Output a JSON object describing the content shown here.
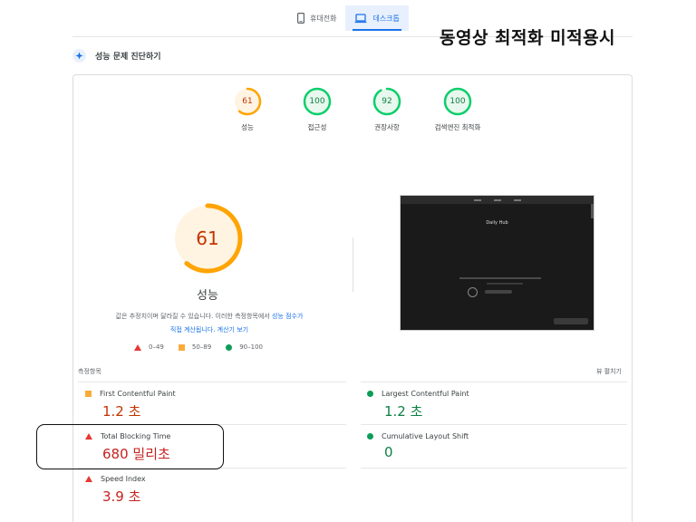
{
  "device_tabs": [
    {
      "label": "휴대전화",
      "icon": "smartphone-icon",
      "active": false
    },
    {
      "label": "데스크톱",
      "icon": "laptop-icon",
      "active": true
    }
  ],
  "overlay_title": "동영상 최적화 미적용시",
  "diagnose": {
    "label": "성능 문제 진단하기",
    "icon": "lighthouse-icon"
  },
  "category_scores": [
    {
      "label": "성능",
      "score": "61",
      "color": "#ffa400"
    },
    {
      "label": "접근성",
      "score": "100",
      "color": "#0cce6b"
    },
    {
      "label": "권장사항",
      "score": "92",
      "color": "#0cce6b"
    },
    {
      "label": "검색엔진 최적화",
      "score": "100",
      "color": "#0cce6b"
    }
  ],
  "performance": {
    "score": "61",
    "fraction": 0.61,
    "label": "성능",
    "description_prefix": "값은 추정치이며 달라질 수 있습니다. 이러한 측정항목에서 ",
    "description_link1": "성능 점수가",
    "description_link2": "직접 계산됩니다.",
    "description_link3": "계산기 보기"
  },
  "legend": [
    {
      "shape": "triangle",
      "range": "0–49",
      "color": "#e53935"
    },
    {
      "shape": "square",
      "range": "50–89",
      "color": "#fbab3a"
    },
    {
      "shape": "circle",
      "range": "90–100",
      "color": "#0c9d58"
    }
  ],
  "screenshot_thumbnail": {
    "app_title": "Daily Hub"
  },
  "metrics_header": "측정항목",
  "view_toggle": "뷰 펼치기",
  "metrics": {
    "fcp": {
      "name": "First Contentful Paint",
      "value": "1.2 초",
      "status": "average"
    },
    "lcp": {
      "name": "Largest Contentful Paint",
      "value": "1.2 초",
      "status": "good"
    },
    "tbt": {
      "name": "Total Blocking Time",
      "value": "680 밀리초",
      "status": "poor"
    },
    "cls": {
      "name": "Cumulative Layout Shift",
      "value": "0",
      "status": "good"
    },
    "si": {
      "name": "Speed Index",
      "value": "3.9 초",
      "status": "poor"
    }
  }
}
